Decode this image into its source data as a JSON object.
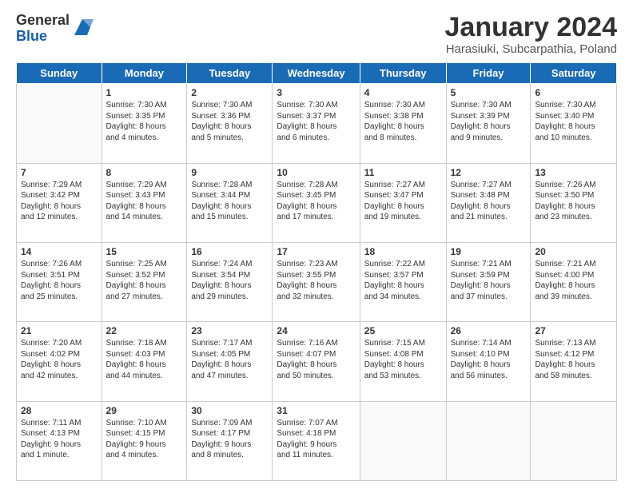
{
  "logo": {
    "general": "General",
    "blue": "Blue"
  },
  "header": {
    "month": "January 2024",
    "location": "Harasiuki, Subcarpathia, Poland"
  },
  "weekdays": [
    "Sunday",
    "Monday",
    "Tuesday",
    "Wednesday",
    "Thursday",
    "Friday",
    "Saturday"
  ],
  "weeks": [
    [
      {
        "day": "",
        "info": ""
      },
      {
        "day": "1",
        "info": "Sunrise: 7:30 AM\nSunset: 3:35 PM\nDaylight: 8 hours\nand 4 minutes."
      },
      {
        "day": "2",
        "info": "Sunrise: 7:30 AM\nSunset: 3:36 PM\nDaylight: 8 hours\nand 5 minutes."
      },
      {
        "day": "3",
        "info": "Sunrise: 7:30 AM\nSunset: 3:37 PM\nDaylight: 8 hours\nand 6 minutes."
      },
      {
        "day": "4",
        "info": "Sunrise: 7:30 AM\nSunset: 3:38 PM\nDaylight: 8 hours\nand 8 minutes."
      },
      {
        "day": "5",
        "info": "Sunrise: 7:30 AM\nSunset: 3:39 PM\nDaylight: 8 hours\nand 9 minutes."
      },
      {
        "day": "6",
        "info": "Sunrise: 7:30 AM\nSunset: 3:40 PM\nDaylight: 8 hours\nand 10 minutes."
      }
    ],
    [
      {
        "day": "7",
        "info": "Sunrise: 7:29 AM\nSunset: 3:42 PM\nDaylight: 8 hours\nand 12 minutes."
      },
      {
        "day": "8",
        "info": "Sunrise: 7:29 AM\nSunset: 3:43 PM\nDaylight: 8 hours\nand 14 minutes."
      },
      {
        "day": "9",
        "info": "Sunrise: 7:28 AM\nSunset: 3:44 PM\nDaylight: 8 hours\nand 15 minutes."
      },
      {
        "day": "10",
        "info": "Sunrise: 7:28 AM\nSunset: 3:45 PM\nDaylight: 8 hours\nand 17 minutes."
      },
      {
        "day": "11",
        "info": "Sunrise: 7:27 AM\nSunset: 3:47 PM\nDaylight: 8 hours\nand 19 minutes."
      },
      {
        "day": "12",
        "info": "Sunrise: 7:27 AM\nSunset: 3:48 PM\nDaylight: 8 hours\nand 21 minutes."
      },
      {
        "day": "13",
        "info": "Sunrise: 7:26 AM\nSunset: 3:50 PM\nDaylight: 8 hours\nand 23 minutes."
      }
    ],
    [
      {
        "day": "14",
        "info": "Sunrise: 7:26 AM\nSunset: 3:51 PM\nDaylight: 8 hours\nand 25 minutes."
      },
      {
        "day": "15",
        "info": "Sunrise: 7:25 AM\nSunset: 3:52 PM\nDaylight: 8 hours\nand 27 minutes."
      },
      {
        "day": "16",
        "info": "Sunrise: 7:24 AM\nSunset: 3:54 PM\nDaylight: 8 hours\nand 29 minutes."
      },
      {
        "day": "17",
        "info": "Sunrise: 7:23 AM\nSunset: 3:55 PM\nDaylight: 8 hours\nand 32 minutes."
      },
      {
        "day": "18",
        "info": "Sunrise: 7:22 AM\nSunset: 3:57 PM\nDaylight: 8 hours\nand 34 minutes."
      },
      {
        "day": "19",
        "info": "Sunrise: 7:21 AM\nSunset: 3:59 PM\nDaylight: 8 hours\nand 37 minutes."
      },
      {
        "day": "20",
        "info": "Sunrise: 7:21 AM\nSunset: 4:00 PM\nDaylight: 8 hours\nand 39 minutes."
      }
    ],
    [
      {
        "day": "21",
        "info": "Sunrise: 7:20 AM\nSunset: 4:02 PM\nDaylight: 8 hours\nand 42 minutes."
      },
      {
        "day": "22",
        "info": "Sunrise: 7:18 AM\nSunset: 4:03 PM\nDaylight: 8 hours\nand 44 minutes."
      },
      {
        "day": "23",
        "info": "Sunrise: 7:17 AM\nSunset: 4:05 PM\nDaylight: 8 hours\nand 47 minutes."
      },
      {
        "day": "24",
        "info": "Sunrise: 7:16 AM\nSunset: 4:07 PM\nDaylight: 8 hours\nand 50 minutes."
      },
      {
        "day": "25",
        "info": "Sunrise: 7:15 AM\nSunset: 4:08 PM\nDaylight: 8 hours\nand 53 minutes."
      },
      {
        "day": "26",
        "info": "Sunrise: 7:14 AM\nSunset: 4:10 PM\nDaylight: 8 hours\nand 56 minutes."
      },
      {
        "day": "27",
        "info": "Sunrise: 7:13 AM\nSunset: 4:12 PM\nDaylight: 8 hours\nand 58 minutes."
      }
    ],
    [
      {
        "day": "28",
        "info": "Sunrise: 7:11 AM\nSunset: 4:13 PM\nDaylight: 9 hours\nand 1 minute."
      },
      {
        "day": "29",
        "info": "Sunrise: 7:10 AM\nSunset: 4:15 PM\nDaylight: 9 hours\nand 4 minutes."
      },
      {
        "day": "30",
        "info": "Sunrise: 7:09 AM\nSunset: 4:17 PM\nDaylight: 9 hours\nand 8 minutes."
      },
      {
        "day": "31",
        "info": "Sunrise: 7:07 AM\nSunset: 4:18 PM\nDaylight: 9 hours\nand 11 minutes."
      },
      {
        "day": "",
        "info": ""
      },
      {
        "day": "",
        "info": ""
      },
      {
        "day": "",
        "info": ""
      }
    ]
  ]
}
